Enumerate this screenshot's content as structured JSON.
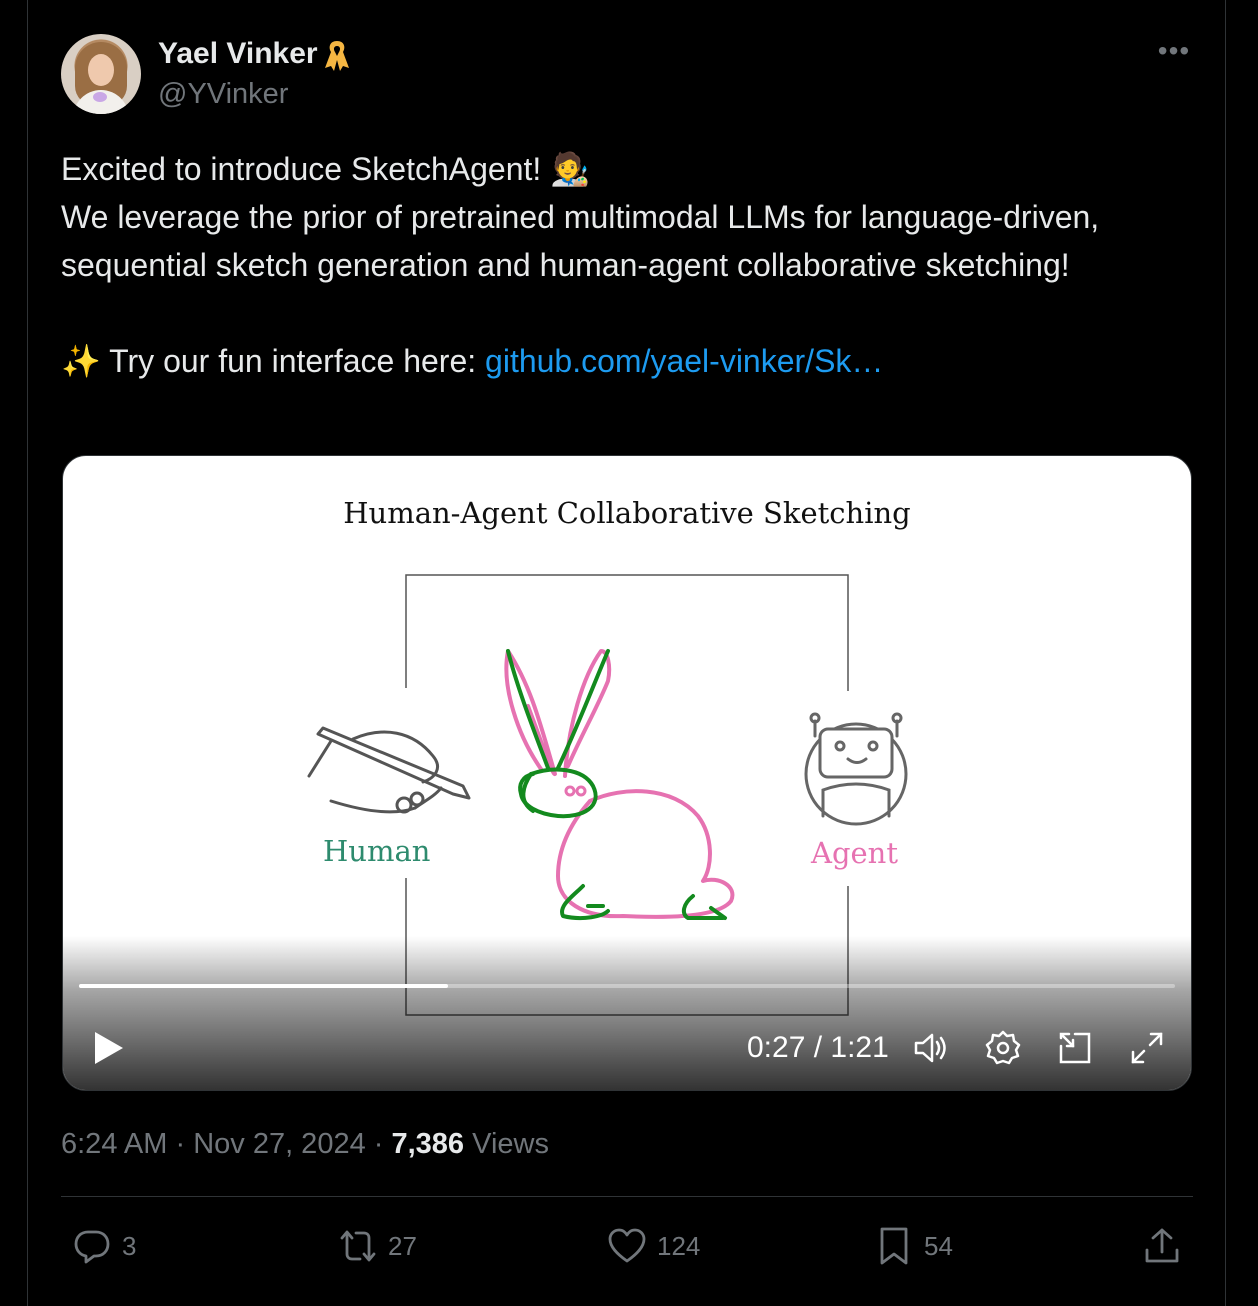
{
  "user": {
    "name": "Yael Vinker",
    "name_badge_emoji": "🎗️",
    "handle": "@YVinker"
  },
  "tweet": {
    "line1": "Excited to introduce SketchAgent! ",
    "line1_emoji": "🧑‍🎨",
    "line2": "We leverage the prior of pretrained multimodal LLMs for language-driven, sequential sketch generation and human-agent collaborative sketching!",
    "line3_emoji": "✨",
    "line3_text": " Try our fun interface here: ",
    "link_text": "github.com/yael-vinker/Sk…"
  },
  "video": {
    "title": "Human-Agent Collaborative Sketching",
    "label_human": "Human",
    "label_agent": "Agent",
    "time": "0:27 / 1:21",
    "progress": 0.337,
    "colors": {
      "human": "#2e8b6e",
      "agent": "#e672b1",
      "stroke_green": "#138a1e"
    }
  },
  "meta": {
    "time": "6:24 AM",
    "sep1": " · ",
    "date": "Nov 27, 2024",
    "sep2": " · ",
    "views_count": "7,386",
    "views_label": " Views"
  },
  "actions": {
    "replies": "3",
    "reposts": "27",
    "likes": "124",
    "bookmarks": "54"
  },
  "icons": [
    "more-icon",
    "ribbon-icon",
    "play-icon",
    "volume-icon",
    "settings-icon",
    "picture-in-picture-icon",
    "fullscreen-icon",
    "reply-icon",
    "repost-icon",
    "like-icon",
    "bookmark-icon",
    "share-icon"
  ]
}
